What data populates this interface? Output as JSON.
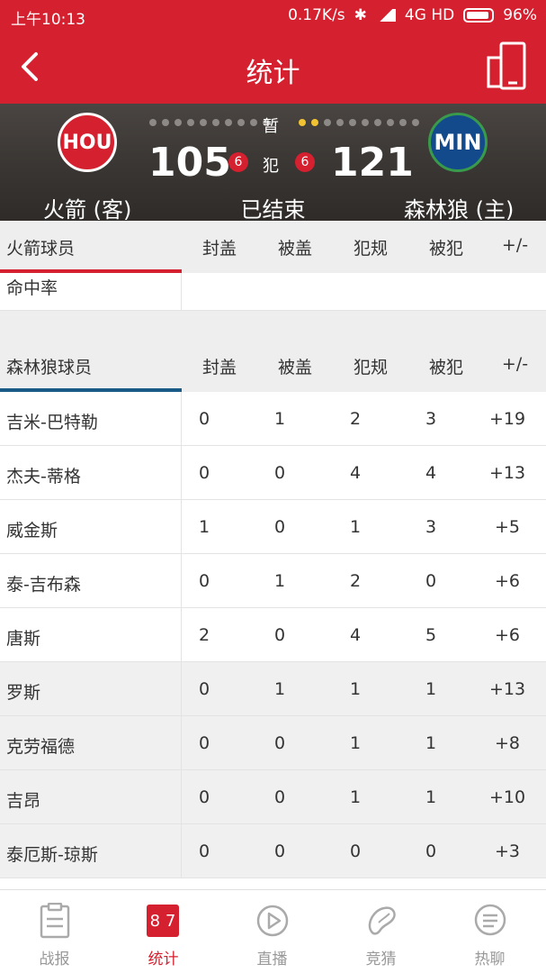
{
  "status": {
    "time": "上午10:13",
    "speed": "0.17K/s",
    "network": "4G HD",
    "battery": "96%"
  },
  "nav": {
    "title": "统计"
  },
  "game": {
    "away": {
      "logo": "HOU",
      "name": "火箭 (客)",
      "score": "105",
      "fouls": "6"
    },
    "home": {
      "logo": "MIN",
      "name": "森林狼 (主)",
      "score": "121",
      "fouls": "6"
    },
    "pause_label": "暂",
    "foul_label": "犯",
    "status": "已结束"
  },
  "stat_columns": [
    "封盖",
    "被盖",
    "犯规",
    "被犯",
    "+/-"
  ],
  "away_section": {
    "header": "火箭球员",
    "partial_row": "命中率"
  },
  "home_section": {
    "header": "森林狼球员"
  },
  "home_players": [
    {
      "name": "吉米-巴特勒",
      "blk": "0",
      "blkd": "1",
      "pf": "2",
      "fd": "3",
      "pm": "+19",
      "bench": false
    },
    {
      "name": "杰夫-蒂格",
      "blk": "0",
      "blkd": "0",
      "pf": "4",
      "fd": "4",
      "pm": "+13",
      "bench": false
    },
    {
      "name": "威金斯",
      "blk": "1",
      "blkd": "0",
      "pf": "1",
      "fd": "3",
      "pm": "+5",
      "bench": false
    },
    {
      "name": "泰-吉布森",
      "blk": "0",
      "blkd": "1",
      "pf": "2",
      "fd": "0",
      "pm": "+6",
      "bench": false
    },
    {
      "name": "唐斯",
      "blk": "2",
      "blkd": "0",
      "pf": "4",
      "fd": "5",
      "pm": "+6",
      "bench": false
    },
    {
      "name": "罗斯",
      "blk": "0",
      "blkd": "1",
      "pf": "1",
      "fd": "1",
      "pm": "+13",
      "bench": true
    },
    {
      "name": "克劳福德",
      "blk": "0",
      "blkd": "0",
      "pf": "1",
      "fd": "1",
      "pm": "+8",
      "bench": true
    },
    {
      "name": "吉昂",
      "blk": "0",
      "blkd": "0",
      "pf": "1",
      "fd": "1",
      "pm": "+10",
      "bench": true
    },
    {
      "name": "泰厄斯-琼斯",
      "blk": "0",
      "blkd": "0",
      "pf": "0",
      "fd": "0",
      "pm": "+3",
      "bench": true
    }
  ],
  "tabs": [
    {
      "label": "战报",
      "icon": "clipboard-icon"
    },
    {
      "label": "统计",
      "icon": "stats-icon",
      "icon_text": "8 7"
    },
    {
      "label": "直播",
      "icon": "play-icon"
    },
    {
      "label": "竞猜",
      "icon": "guess-icon"
    },
    {
      "label": "热聊",
      "icon": "chat-icon"
    }
  ],
  "colors": {
    "brand": "#d4202f",
    "home_accent": "#1a5a86"
  }
}
